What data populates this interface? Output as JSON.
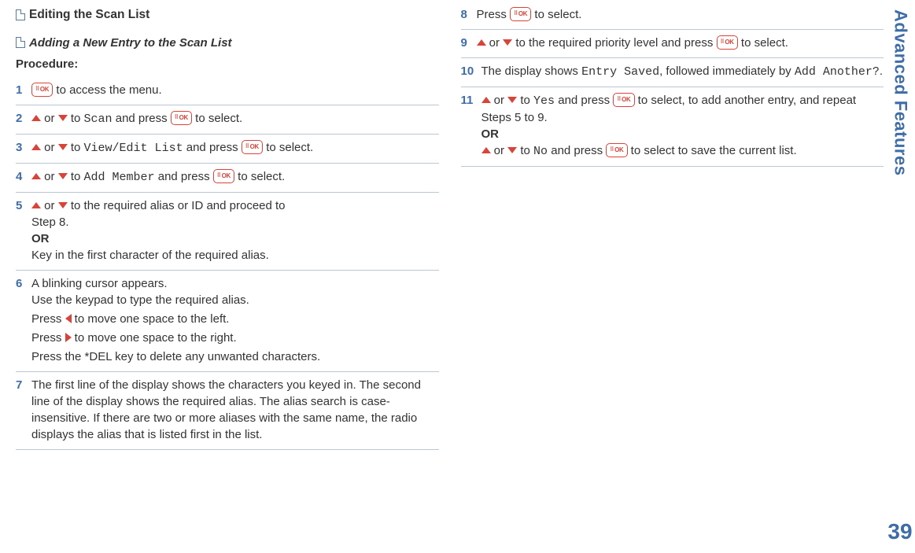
{
  "sidebar": {
    "title": "Advanced Features",
    "pageNumber": "39"
  },
  "left": {
    "heading": "Editing the Scan List",
    "subheading": "Adding a New Entry to the Scan List",
    "procedureLabel": "Procedure:",
    "steps": {
      "s1": {
        "num": "1",
        "tail": " to access the menu."
      },
      "s2": {
        "num": "2",
        "mid": " to ",
        "target": "Scan",
        "mid2": " and press ",
        "tail": " to select."
      },
      "s3": {
        "num": "3",
        "mid": " to ",
        "target": "View/Edit List",
        "mid2": " and press ",
        "tail": " to select."
      },
      "s4": {
        "num": "4",
        "mid": " to ",
        "target": "Add Member",
        "mid2": " and press ",
        "tail": " to select."
      },
      "s5": {
        "num": "5",
        "line1tail": " to the required alias or ID and proceed to",
        "line2": "Step 8.",
        "or": "OR",
        "line3": "Key in the first character of the required alias."
      },
      "s6": {
        "num": "6",
        "l1": "A blinking cursor appears.",
        "l2": "Use the keypad to type the required alias.",
        "l3pre": "Press ",
        "l3post": " to move one space to the left.",
        "l4pre": "Press ",
        "l4post": " to move one space to the right.",
        "l5": "Press the *DEL key to delete any unwanted characters."
      },
      "s7": {
        "num": "7",
        "text": "The first line of the display shows the characters you keyed in. The second line of the display shows the required alias. The alias search is case-insensitive. If there are two or more aliases with the same name, the radio displays the alias that is listed first in the list."
      }
    }
  },
  "right": {
    "steps": {
      "s8": {
        "num": "8",
        "pre": "Press ",
        "tail": " to select."
      },
      "s9": {
        "num": "9",
        "mid": " to the required priority level and press ",
        "tail": " to select."
      },
      "s10": {
        "num": "10",
        "pre": "The display shows ",
        "m1": "Entry Saved",
        "mid": ", followed immediately by ",
        "m2": "Add Another?",
        "tail": "."
      },
      "s11": {
        "num": "11",
        "a_mid": " to ",
        "a_target": "Yes",
        "a_mid2": " and press ",
        "a_tail": " to select, to add another entry, and repeat Steps 5 to 9.",
        "or": "OR",
        "b_mid": " to ",
        "b_target": "No",
        "b_mid2": " and press ",
        "b_tail": " to select to save the current list."
      }
    }
  },
  "labels": {
    "or": " or "
  }
}
